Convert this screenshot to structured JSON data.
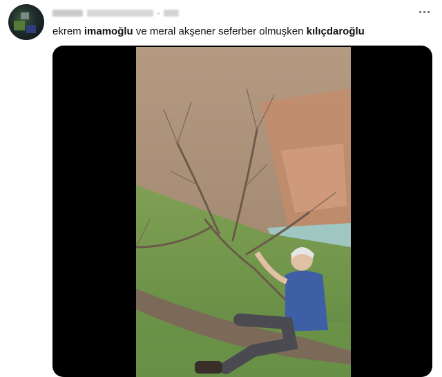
{
  "tweet": {
    "text_parts": [
      {
        "text": "ekrem ",
        "bold": false
      },
      {
        "text": "imamoğlu",
        "bold": true
      },
      {
        "text": " ve meral akşener seferber olmuşken ",
        "bold": false
      },
      {
        "text": "kılıçdaroğlu",
        "bold": true
      }
    ]
  },
  "icons": {
    "more": "more-horizontal-icon"
  },
  "colors": {
    "text": "#0f1419",
    "secondary": "#536471",
    "media_bg": "#000000"
  }
}
